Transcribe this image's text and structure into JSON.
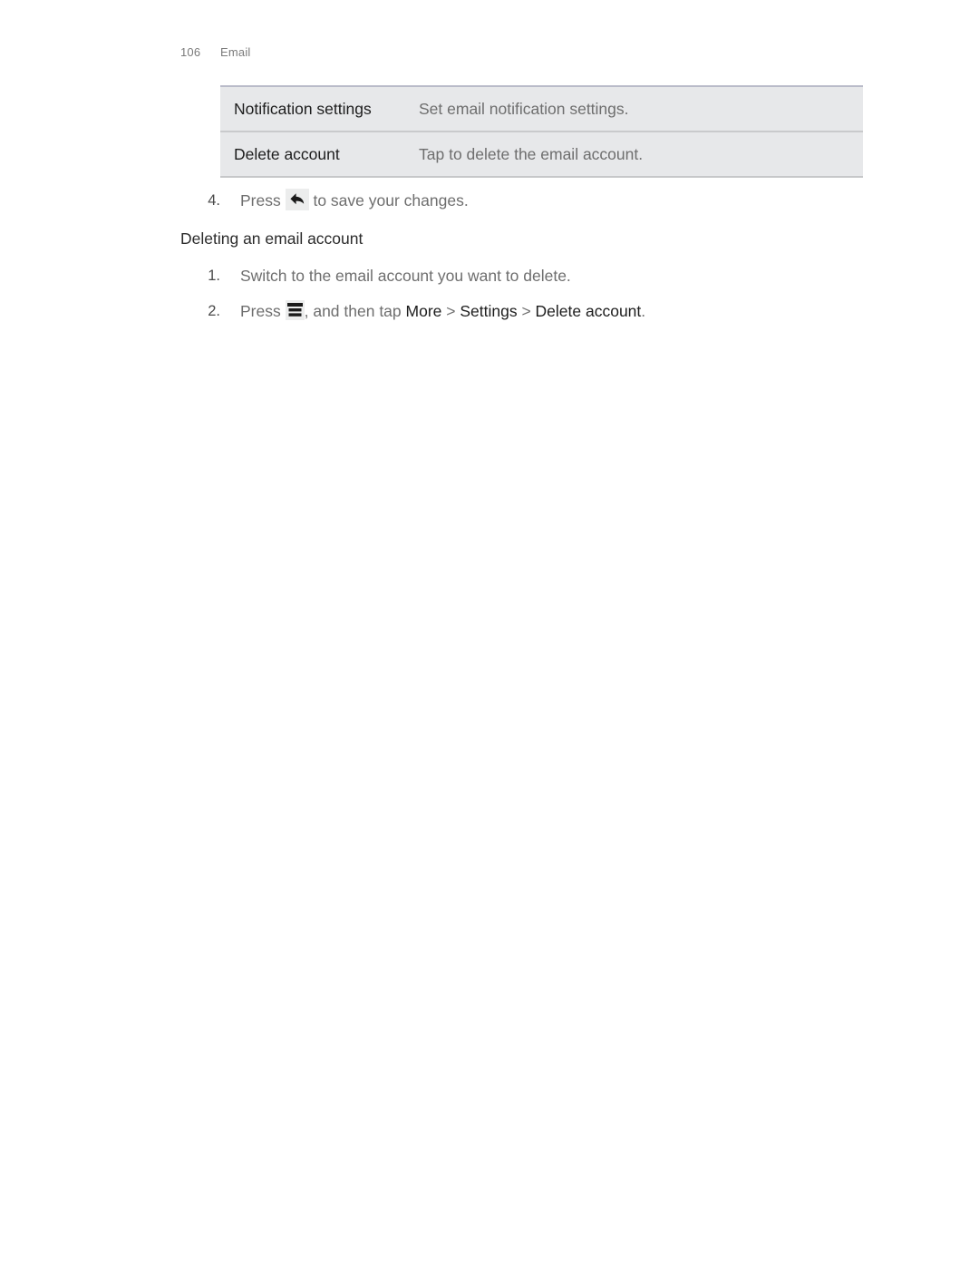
{
  "header": {
    "page_number": "106",
    "section": "Email"
  },
  "settings_table": {
    "rows": [
      {
        "name": "Notification settings",
        "description": "Set email notification settings."
      },
      {
        "name": "Delete account",
        "description": "Tap to delete the email account."
      }
    ]
  },
  "step_four": {
    "number": "4.",
    "text_before": "Press ",
    "icon": "back-arrow-icon",
    "text_after": " to save your changes."
  },
  "section": {
    "heading": "Deleting an email account",
    "steps": [
      {
        "number": "1.",
        "text": "Switch to the email account you want to delete."
      },
      {
        "number": "2.",
        "text_before": "Press ",
        "icon": "menu-icon",
        "text_middle": ", and then tap ",
        "path_1": "More",
        "separator_1": " > ",
        "path_2": "Settings",
        "separator_2": " > ",
        "path_3": "Delete account",
        "text_after": "."
      }
    ]
  },
  "colors": {
    "table_background": "#e7e8ea",
    "table_top_border": "#b9bbc9",
    "table_row_border": "#c9cacc",
    "body_text": "#6e6e6e",
    "emphasis_text": "#1d1d1d",
    "header_text": "#7a7a7a",
    "icon_background": "#eceded"
  }
}
